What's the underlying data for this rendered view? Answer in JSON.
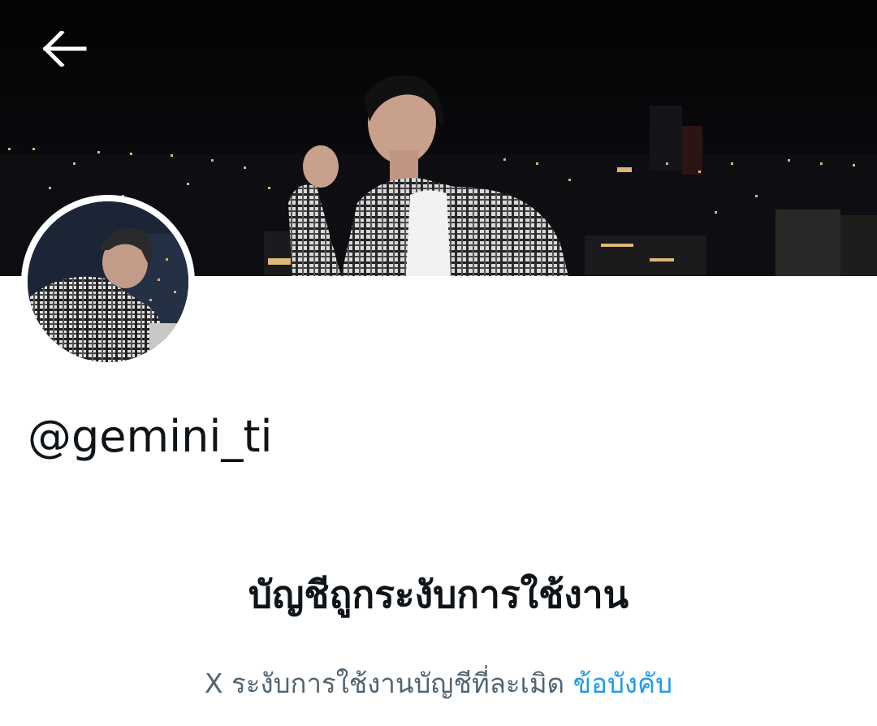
{
  "header": {
    "back_icon": "arrow-left-icon",
    "back_icon_color": "#ffffff"
  },
  "banner": {
    "description_icon": "cover-photo-night-city"
  },
  "profile": {
    "handle": "@gemini_ti",
    "avatar_icon": "profile-photo"
  },
  "suspension": {
    "title": "บัญชีถูกระงับการใช้งาน",
    "description": "X ระงับการใช้งานบัญชีที่ละเมิด",
    "link_text": "ข้อบังคับ",
    "link_color": "#1d9bf0"
  },
  "colors": {
    "text_primary": "#0f1419",
    "text_secondary": "#536471",
    "background": "#ffffff"
  }
}
